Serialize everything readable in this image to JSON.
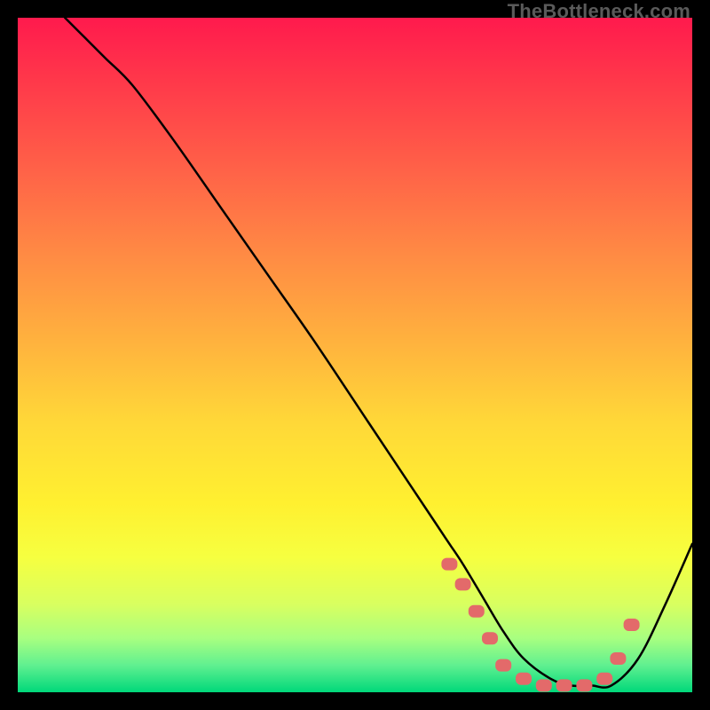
{
  "watermark": "TheBottleneck.com",
  "chart_data": {
    "type": "line",
    "title": "",
    "xlabel": "",
    "ylabel": "",
    "xlim": [
      0,
      100
    ],
    "ylim": [
      0,
      100
    ],
    "series": [
      {
        "name": "curve",
        "x": [
          7,
          10,
          13,
          17,
          23,
          30,
          37,
          44,
          52,
          58,
          62,
          64,
          66,
          69,
          72,
          75,
          79,
          82,
          85,
          88,
          92,
          96,
          100
        ],
        "y": [
          100,
          97,
          94,
          90,
          82,
          72,
          62,
          52,
          40,
          31,
          25,
          22,
          19,
          14,
          9,
          5,
          2,
          1,
          1,
          1,
          5,
          13,
          22
        ]
      }
    ],
    "markers": [
      {
        "x": 64,
        "y": 19
      },
      {
        "x": 66,
        "y": 16
      },
      {
        "x": 68,
        "y": 12
      },
      {
        "x": 70,
        "y": 8
      },
      {
        "x": 72,
        "y": 4
      },
      {
        "x": 75,
        "y": 2
      },
      {
        "x": 78,
        "y": 1
      },
      {
        "x": 81,
        "y": 1
      },
      {
        "x": 84,
        "y": 1
      },
      {
        "x": 87,
        "y": 2
      },
      {
        "x": 89,
        "y": 5
      },
      {
        "x": 91,
        "y": 10
      }
    ],
    "marker_color": "#e36a6a"
  }
}
